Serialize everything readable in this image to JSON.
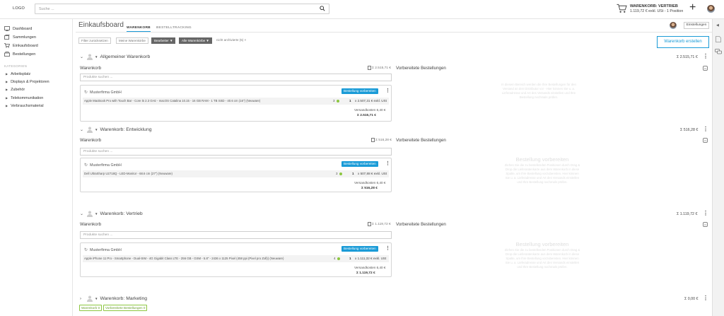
{
  "header": {
    "logo": "LOGO",
    "search_placeholder": "Suche ...",
    "cart_title": "WARENKORB: VERTRIEB",
    "cart_sub": "1.119,72 € exkl. USt - 1 Position",
    "add_icon": "plus-icon"
  },
  "sidebar": {
    "items": [
      {
        "label": "Dashboard",
        "icon": "dashboard-icon"
      },
      {
        "label": "Sammlungen",
        "icon": "collections-icon"
      },
      {
        "label": "Einkaufsboard",
        "icon": "cart-icon"
      },
      {
        "label": "Bestellungen",
        "icon": "orders-icon"
      }
    ],
    "category_title": "KATEGORIEN",
    "categories": [
      "Arbeitsplatz",
      "Displays & Projektoren",
      "Zubehör",
      "Telekommunikation",
      "Verbrauchsmaterial"
    ]
  },
  "main": {
    "title": "Einkaufsboard",
    "tabs": [
      {
        "label": "WARENKORB"
      },
      {
        "label": "BESTELLTRACKING"
      }
    ],
    "settings_label": "Einstellungen",
    "filters": [
      "Filter zurücksetzen",
      "Meine Warenkörbe",
      "Bearbeiter ▼",
      "Alle Warenkörbe ▼",
      "nicht archivierte (5) ×"
    ],
    "create_basket": "Warenkorb erstellen",
    "label_basket": "Warenkorb",
    "label_prepared": "Vorbereitete Bestellungen",
    "product_search": "Produkte suchen ...",
    "prepare_order": "Bestellung vorbereiten",
    "shipping_label": "Versandkosten 6,40 €",
    "placeholder_title": "Bestellung vorbereiten",
    "placeholder_text": "Ziehen Sie die zu bestellenden Positionen durch Drag & Drop die Lieferantenkarte aus dem Warenkorb in diese Spalte, um Ihre Bestellung vorzubereiten. Hier können Sie u. a. Lieferadresse und Art des Versands einstellen und Ihre Bestellung nochmals prüfen.",
    "placeholder_text_small": "In diesem Bereich werden die Ihre Bestellungen für den Versand an den Distributor vor - Hier können Sie u. a. Lieferadresse und Art des Versands einstellen und Ihre Bestellung nochmals prüfen."
  },
  "baskets": [
    {
      "name": "Allgemeiner Warenkorb",
      "total": "Σ 2.515,71 €",
      "basket_total": "Σ 2.515,71 €",
      "supplier": "Musterfirma GmbH",
      "product": "Apple MacBook Pro with Touch Bar - Core i5 2.3 GHz - macOS Catalina 10.15 - 16 GB RAM - 1 TB SSD - 40.6 cm (16\") (Neuware)",
      "stock": "3",
      "qty": "1",
      "price": "x  2.507,31 € exkl. USt",
      "sum": "Σ 2.515,71 €"
    },
    {
      "name": "Warenkorb: Entwicklung",
      "total": "Σ 516,28 €",
      "basket_total": "Σ 516,28 €",
      "supplier": "Musterfirma GmbH",
      "product": "Dell UltraSharp U2718Q - LED-Monitor - 68.6 cm (27\") (Neuware)",
      "stock": "3",
      "qty": "1",
      "price": "x  507,88 € exkl. USt",
      "sum": "Σ 516,28 €"
    },
    {
      "name": "Warenkorb: Vertrieb",
      "total": "Σ 1.119,72 €",
      "basket_total": "Σ 1.119,72 €",
      "supplier": "Musterfirma GmbH",
      "product": "Apple iPhone 11 Pro - Smartphone - Dual-SIM - 4G Gigabit Class LTE - 256 GB - GSM - 5.8\" - 2436 x 1125 Pixel (458 ppi (Pixel pro Zoll)) (Neuware)",
      "stock": "4",
      "qty": "1",
      "price": "x  1.111,32 € exkl. USt",
      "sum": "Σ 1.119,72 €"
    },
    {
      "name": "Warenkorb: Marketing",
      "total": "Σ 0,00 €",
      "badge_basket": "Warenkorb 0",
      "badge_prepared": "Vorbereitete Bestellungen 0"
    }
  ],
  "colors": {
    "accent": "#1a9bd7",
    "stock_ok": "#8cc63f"
  }
}
